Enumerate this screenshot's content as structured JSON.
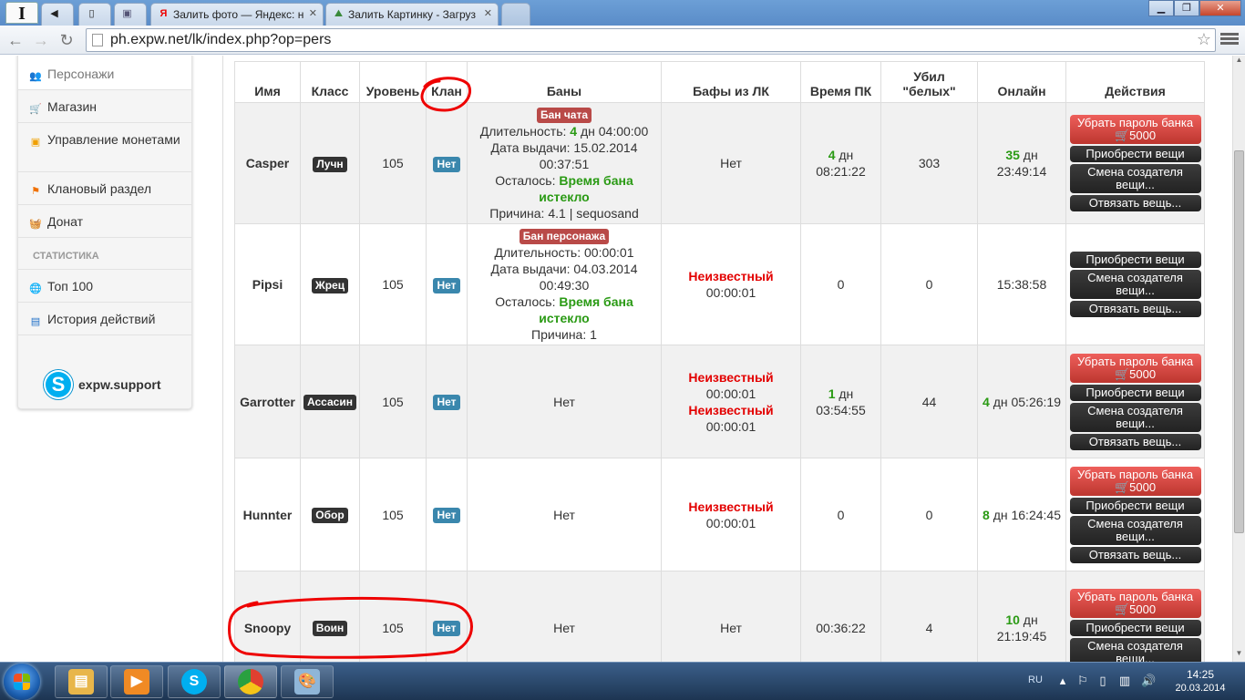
{
  "browser": {
    "app_icon": "I",
    "tabs": [
      {
        "label": "",
        "icon": "speaker-icon"
      },
      {
        "label": "",
        "icon": "page-icon"
      },
      {
        "label": "",
        "icon": "image-icon"
      },
      {
        "label": "Залить фото — Яндекс: н",
        "icon": "yandex-icon"
      },
      {
        "label": "Залить Картинку - Загруз",
        "icon": "image-upload-icon"
      },
      {
        "label": "",
        "icon": "new-tab-icon"
      }
    ],
    "url": "ph.expw.net/lk/index.php?op=pers"
  },
  "sidebar": {
    "items": [
      {
        "label": "Персонажи",
        "icon": "users-icon",
        "color": "#f0a000"
      },
      {
        "label": "Магазин",
        "icon": "cart-icon",
        "color": "#2a9a14"
      },
      {
        "label": "Управление монетами",
        "icon": "coin-icon",
        "color": "#f0a000"
      },
      {
        "label": "Клановый раздел",
        "icon": "flag-icon",
        "color": "#f07000"
      },
      {
        "label": "Донат",
        "icon": "basket-icon",
        "color": "#c0302a"
      }
    ],
    "stats_header": "СТАТИСТИКА",
    "stats_items": [
      {
        "label": "Топ 100",
        "icon": "globe-icon",
        "color": "#1e6fc8"
      },
      {
        "label": "История действий",
        "icon": "document-icon",
        "color": "#1e6fc8"
      }
    ],
    "skype": {
      "letter": "S",
      "label": "expw.support"
    }
  },
  "table": {
    "headers": {
      "name": "Имя",
      "class": "Класс",
      "level": "Уровень",
      "clan": "Клан",
      "bans": "Баны",
      "buffs": "Бафы из ЛК",
      "pk_time": "Время ПК",
      "kills_1": "Убил",
      "kills_2": "\"белых\"",
      "online": "Онлайн",
      "actions": "Действия"
    },
    "rows": [
      {
        "name": "Casper",
        "class": "Лучн",
        "level": "105",
        "clan": "Нет",
        "ban": {
          "type": "Бан чата",
          "duration_label": "Длительность:",
          "duration_num": "4",
          "duration_rest": "дн 04:00:00",
          "issued_label": "Дата выдачи:",
          "issued_date": "15.02.2014",
          "issued_time": "00:37:51",
          "left_label": "Осталось:",
          "left_value": "Время бана истекло",
          "reason_label": "Причина:",
          "reason_value": "4.1 | sequosand"
        },
        "buffs": "Нет",
        "pk_num": "4",
        "pk_unit": "дн",
        "pk_time": "08:21:22",
        "kills": "303",
        "online_num": "35",
        "online_unit": "дн",
        "online_time": "23:49:14",
        "actions": [
          {
            "label": "Убрать пароль банка",
            "price": "5000",
            "style": "red"
          },
          {
            "label": "Приобрести вещи",
            "style": "dark"
          },
          {
            "label": "Смена создателя вещи...",
            "style": "dark"
          },
          {
            "label": "Отвязать вещь...",
            "style": "dark"
          }
        ]
      },
      {
        "name": "Pipsi",
        "class": "Жрец",
        "level": "105",
        "clan": "Нет",
        "ban": {
          "type": "Бан персонажа",
          "duration_label": "Длительность:",
          "duration_num": "",
          "duration_rest": "00:00:01",
          "issued_label": "Дата выдачи:",
          "issued_date": "04.03.2014",
          "issued_time": "00:49:30",
          "left_label": "Осталось:",
          "left_value": "Время бана истекло",
          "reason_label": "Причина:",
          "reason_value": "1"
        },
        "buffs_red": "Неизвестный",
        "buffs_time": "00:00:01",
        "pk_plain": "0",
        "kills": "0",
        "online_plain": "15:38:58",
        "actions": [
          {
            "label": "Приобрести вещи",
            "style": "dark"
          },
          {
            "label": "Смена создателя вещи...",
            "style": "dark"
          },
          {
            "label": "Отвязать вещь...",
            "style": "dark"
          }
        ]
      },
      {
        "name": "Garrotter",
        "class": "Ассасин",
        "level": "105",
        "clan": "Нет",
        "ban_plain": "Нет",
        "buffs_list": [
          {
            "name": "Неизвестный",
            "time": "00:00:01"
          },
          {
            "name": "Неизвестный",
            "time": "00:00:01"
          }
        ],
        "pk_num": "1",
        "pk_unit": "дн",
        "pk_time": "03:54:55",
        "kills": "44",
        "online_num": "4",
        "online_rest": "дн 05:26:19",
        "actions": [
          {
            "label": "Убрать пароль банка",
            "price": "5000",
            "style": "red"
          },
          {
            "label": "Приобрести вещи",
            "style": "dark"
          },
          {
            "label": "Смена создателя вещи...",
            "style": "dark"
          },
          {
            "label": "Отвязать вещь...",
            "style": "dark"
          }
        ]
      },
      {
        "name": "Hunnter",
        "class": "Обор",
        "level": "105",
        "clan": "Нет",
        "ban_plain": "Нет",
        "buffs_red": "Неизвестный",
        "buffs_time": "00:00:01",
        "pk_plain": "0",
        "kills": "0",
        "online_num": "8",
        "online_rest": "дн 16:24:45",
        "actions": [
          {
            "label": "Убрать пароль банка",
            "price": "5000",
            "style": "red"
          },
          {
            "label": "Приобрести вещи",
            "style": "dark"
          },
          {
            "label": "Смена создателя вещи...",
            "style": "dark"
          },
          {
            "label": "Отвязать вещь...",
            "style": "dark"
          }
        ]
      },
      {
        "name": "Snoopy",
        "class": "Воин",
        "level": "105",
        "clan": "Нет",
        "ban_plain": "Нет",
        "buffs": "Нет",
        "pk_plain": "00:36:22",
        "kills": "4",
        "online_num": "10",
        "online_unit": "дн",
        "online_time": "21:19:45",
        "actions": [
          {
            "label": "Убрать пароль банка",
            "price": "5000",
            "style": "red"
          },
          {
            "label": "Приобрести вещи",
            "style": "dark"
          },
          {
            "label": "Смена создателя вещи...",
            "style": "dark"
          }
        ]
      }
    ]
  },
  "taskbar": {
    "apps": [
      {
        "icon": "explorer-icon",
        "color": "#e8b64a"
      },
      {
        "icon": "media-player-icon",
        "color": "#f08a24"
      },
      {
        "icon": "skype-icon",
        "color": "#00aff0",
        "letter": "S"
      },
      {
        "icon": "chrome-icon",
        "color": "#e04030"
      },
      {
        "icon": "paint-icon",
        "color": "#8fb6d8"
      }
    ],
    "lang": "RU",
    "time": "14:25",
    "date": "20.03.2014"
  }
}
